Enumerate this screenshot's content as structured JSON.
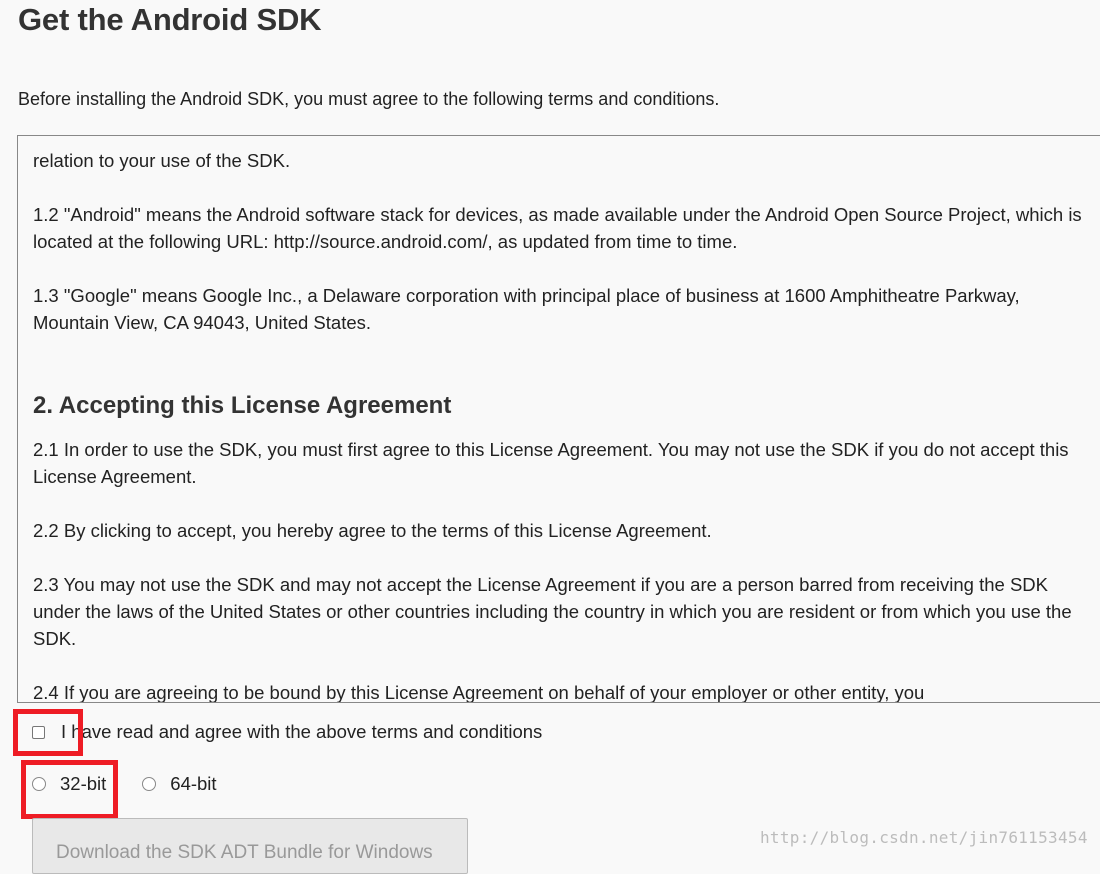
{
  "page": {
    "title": "Get the Android SDK",
    "intro": "Before installing the Android SDK, you must agree to the following terms and conditions."
  },
  "terms": {
    "p_top_partial": "relation to your use of the SDK.",
    "p_1_2": "1.2 \"Android\" means the Android software stack for devices, as made available under the Android Open Source Project, which is located at the following URL: http://source.android.com/, as updated from time to time.",
    "p_1_3": "1.3 \"Google\" means Google Inc., a Delaware corporation with principal place of business at 1600 Amphitheatre Parkway, Mountain View, CA 94043, United States.",
    "section_2_heading": "2. Accepting this License Agreement",
    "p_2_1": "2.1 In order to use the SDK, you must first agree to this License Agreement. You may not use the SDK if you do not accept this License Agreement.",
    "p_2_2": "2.2 By clicking to accept, you hereby agree to the terms of this License Agreement.",
    "p_2_3": "2.3 You may not use the SDK and may not accept the License Agreement if you are a person barred from receiving the SDK under the laws of the United States or other countries including the country in which you are resident or from which you use the SDK.",
    "p_2_4_partial": "2.4 If you are agreeing to be bound by this License Agreement on behalf of your employer or other entity, you"
  },
  "agreement": {
    "checkbox_label": "I have read and agree with the above terms and conditions",
    "checked": false
  },
  "architecture": {
    "options": [
      {
        "label": "32-bit",
        "selected": false
      },
      {
        "label": "64-bit",
        "selected": false
      }
    ]
  },
  "download": {
    "button_label": "Download the SDK ADT Bundle for Windows"
  },
  "watermark": "http://blog.csdn.net/jin761153454",
  "colors": {
    "highlight": "#ee1c25",
    "background": "#f9f9f9",
    "button_disabled_text": "#999999"
  }
}
